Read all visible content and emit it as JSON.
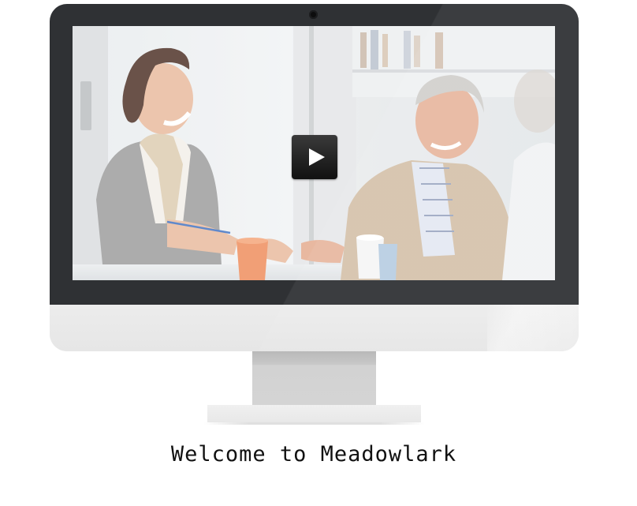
{
  "welcome": {
    "text": "Welcome to Meadowlark"
  },
  "video": {
    "play_icon": "play-icon"
  },
  "colors": {
    "bezel": "#2f3134",
    "chin": "#eaeaea",
    "stand": "#d4d4d4"
  }
}
